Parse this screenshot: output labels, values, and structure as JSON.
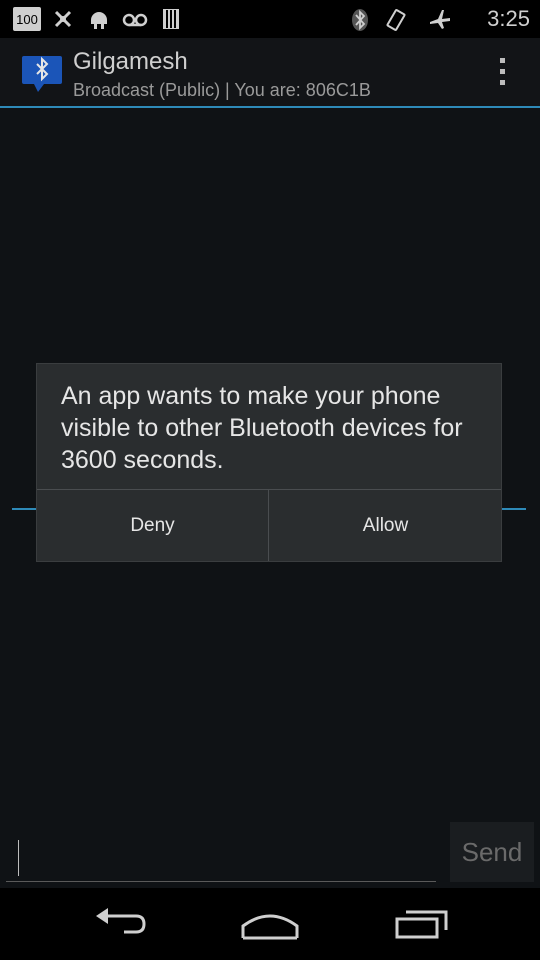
{
  "status_bar": {
    "battery_label": "100",
    "time": "3:25"
  },
  "action_bar": {
    "title": "Gilgamesh",
    "subtitle": "Broadcast (Public) | You are: 806C1B"
  },
  "compose": {
    "send_label": "Send"
  },
  "dialog": {
    "message": "An app wants to make your phone visible to other Bluetooth devices for 3600 seconds.",
    "deny_label": "Deny",
    "allow_label": "Allow"
  },
  "colors": {
    "accent": "#2e8ab8",
    "dialog_bg": "#2a2d2f",
    "content_bg": "#0f1215"
  },
  "icons": [
    "battery-100-icon",
    "usb-debug-icon",
    "android-icon",
    "voicemail-icon",
    "sd-card-icon",
    "bluetooth-icon",
    "vibrate-icon",
    "airplane-icon",
    "app-bluetooth-icon",
    "overflow-menu-icon",
    "back-icon",
    "home-icon",
    "recents-icon"
  ]
}
